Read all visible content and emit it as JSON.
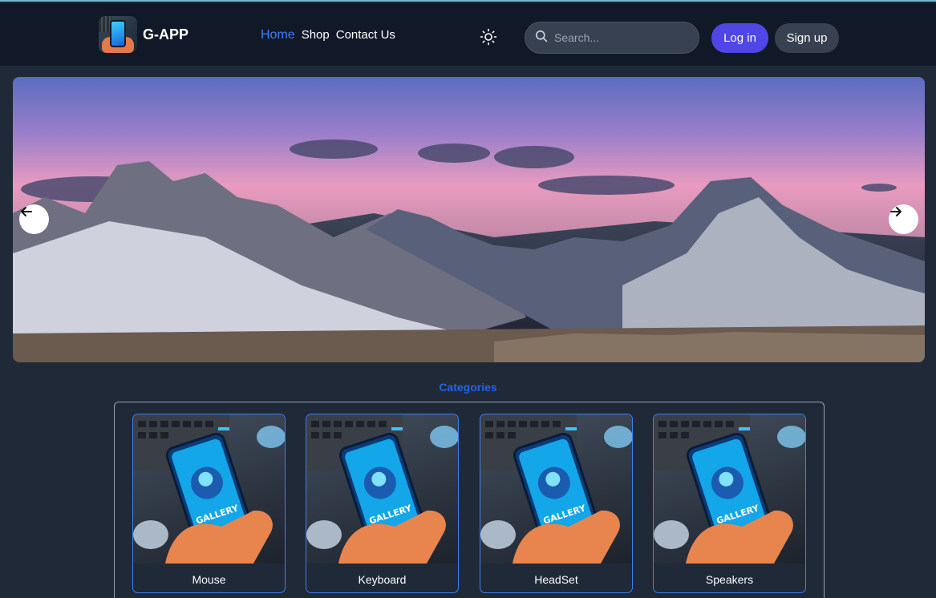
{
  "brand": {
    "name": "G-APP"
  },
  "nav": {
    "links": [
      {
        "label": "Home",
        "active": true
      },
      {
        "label": "Shop",
        "active": false
      },
      {
        "label": "Contact Us",
        "active": false
      }
    ]
  },
  "theme_toggle": {
    "icon": "sun-icon"
  },
  "search": {
    "placeholder": "Search..."
  },
  "auth": {
    "login_label": "Log in",
    "signup_label": "Sign up"
  },
  "hero": {
    "prev_icon": "arrow-left-icon",
    "next_icon": "arrow-right-icon"
  },
  "categories": {
    "title": "Categories",
    "items": [
      {
        "label": "Mouse",
        "image_text": "GALLERY"
      },
      {
        "label": "Keyboard",
        "image_text": "GALLERY"
      },
      {
        "label": "HeadSet",
        "image_text": "GALLERY"
      },
      {
        "label": "Speakers",
        "image_text": "GALLERY"
      }
    ]
  },
  "colors": {
    "accent": "#4f46e5",
    "link_active": "#3b82f6",
    "background": "#1f2937",
    "navbar": "#111827"
  }
}
